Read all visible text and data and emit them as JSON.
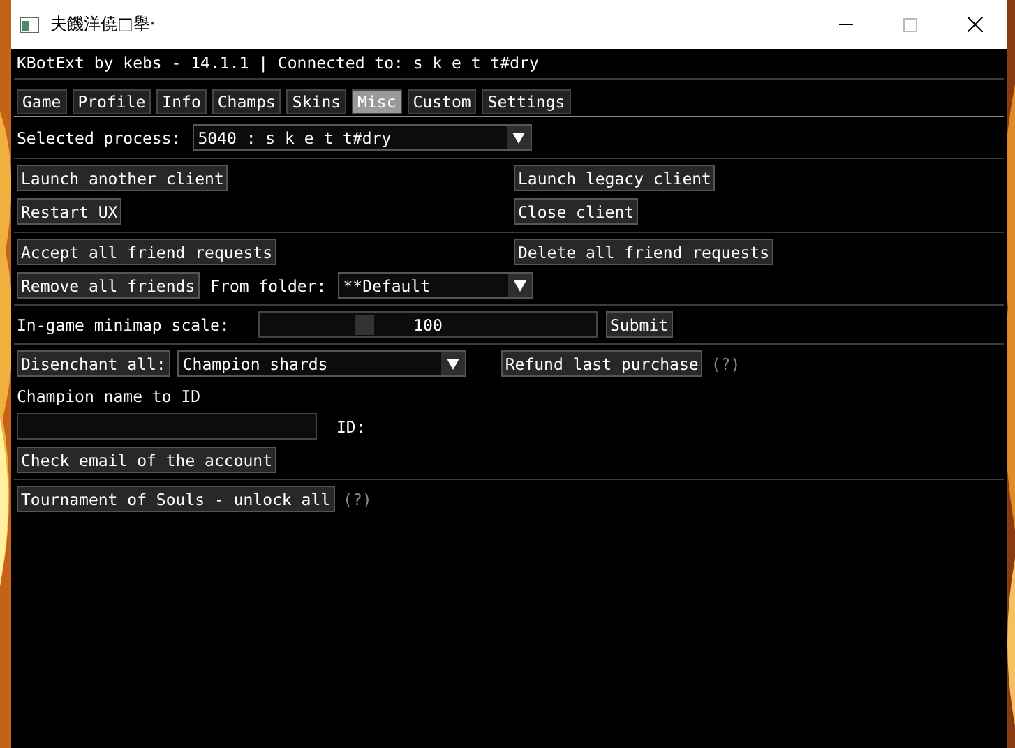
{
  "window": {
    "title": "夫饑洋僥□擧·"
  },
  "header": "KBotExt by kebs - 14.1.1 | Connected to: s k e t t#dry",
  "tabs": [
    {
      "label": "Game",
      "selected": false
    },
    {
      "label": "Profile",
      "selected": false
    },
    {
      "label": "Info",
      "selected": false
    },
    {
      "label": "Champs",
      "selected": false
    },
    {
      "label": "Skins",
      "selected": false
    },
    {
      "label": "Misc",
      "selected": true
    },
    {
      "label": "Custom",
      "selected": false
    },
    {
      "label": "Settings",
      "selected": false
    }
  ],
  "process": {
    "label": "Selected process:",
    "value": "5040 : s k e t t#dry"
  },
  "client_buttons": [
    [
      "Launch another client",
      "Launch legacy client"
    ],
    [
      "Restart UX",
      "Close client"
    ]
  ],
  "friend_buttons": {
    "accept": "Accept all friend requests",
    "delete": "Delete all friend requests",
    "remove": "Remove all friends",
    "folder_label": "From folder:",
    "folder_value": "**Default"
  },
  "minimap": {
    "label": "In-game minimap scale:",
    "level": 0.3,
    "reading": "100",
    "button": "Submit"
  },
  "disenchant": {
    "button": "Disenchant all:",
    "value": "Champion shards",
    "refund": "Refund last purchase",
    "help": "(?)"
  },
  "champion_id": {
    "label": "Champion name to ID",
    "id_label": "ID:"
  },
  "check_email": "Check email of the account",
  "tournament": {
    "button": "Tournament of Souls - unlock all",
    "help": "(?)"
  }
}
